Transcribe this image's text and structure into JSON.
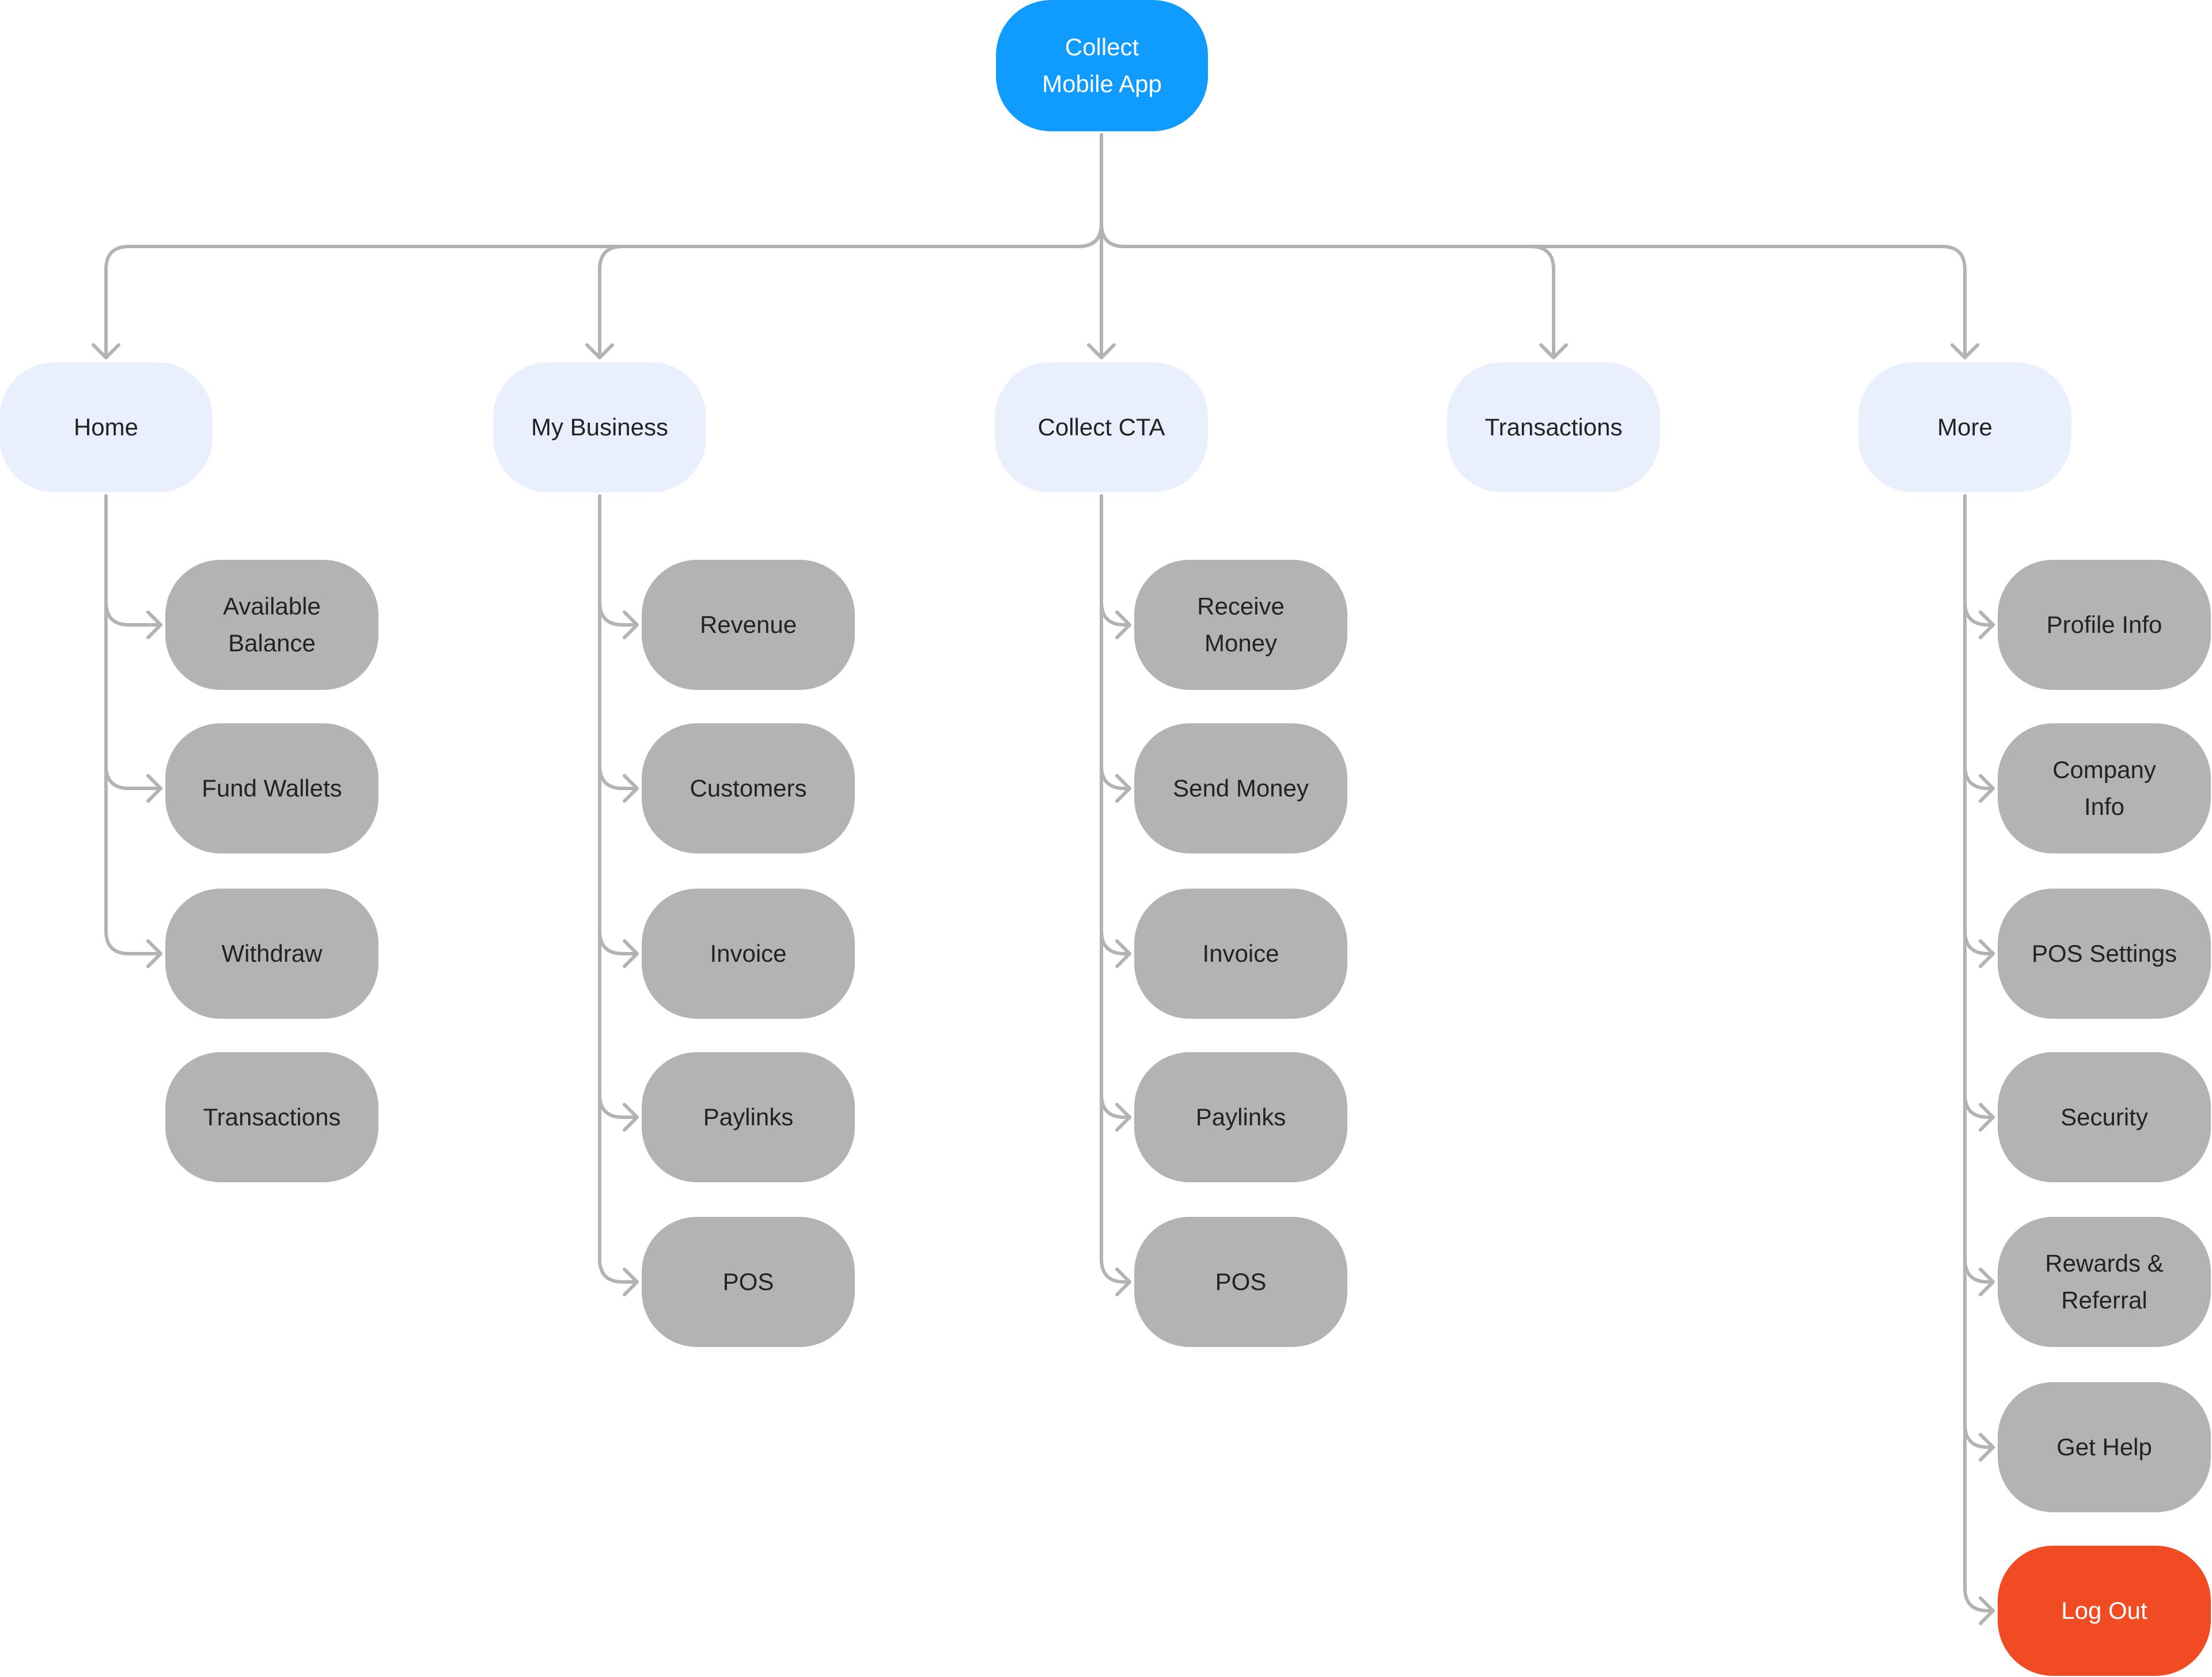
{
  "diagram": {
    "type": "sitemap",
    "colors": {
      "root": "#0f9bff",
      "section": "#e9effd",
      "page": "#b3b3b3",
      "danger": "#f04b23",
      "connector": "#b3b3b3",
      "text": "#232323"
    },
    "root": {
      "label": "Collect\nMobile App"
    },
    "sections": [
      {
        "id": "home",
        "label": "Home",
        "children": [
          {
            "label": "Available\nBalance",
            "linked": true
          },
          {
            "label": "Fund Wallets",
            "linked": true
          },
          {
            "label": "Withdraw",
            "linked": true
          },
          {
            "label": "Transactions",
            "linked": false
          }
        ]
      },
      {
        "id": "my-business",
        "label": "My Business",
        "children": [
          {
            "label": "Revenue",
            "linked": true
          },
          {
            "label": "Customers",
            "linked": true
          },
          {
            "label": "Invoice",
            "linked": true
          },
          {
            "label": "Paylinks",
            "linked": true
          },
          {
            "label": "POS",
            "linked": true
          }
        ]
      },
      {
        "id": "collect-cta",
        "label": "Collect CTA",
        "children": [
          {
            "label": "Receive\nMoney",
            "linked": true
          },
          {
            "label": "Send Money",
            "linked": true
          },
          {
            "label": "Invoice",
            "linked": true
          },
          {
            "label": "Paylinks",
            "linked": true
          },
          {
            "label": "POS",
            "linked": true
          }
        ]
      },
      {
        "id": "transactions",
        "label": "Transactions",
        "children": []
      },
      {
        "id": "more",
        "label": "More",
        "children": [
          {
            "label": "Profile Info",
            "linked": true
          },
          {
            "label": "Company\nInfo",
            "linked": true
          },
          {
            "label": "POS Settings",
            "linked": true
          },
          {
            "label": "Security",
            "linked": true
          },
          {
            "label": "Rewards &\nReferral",
            "linked": true
          },
          {
            "label": "Get Help",
            "linked": true
          },
          {
            "label": "Log Out",
            "linked": true,
            "variant": "danger"
          }
        ]
      }
    ]
  }
}
